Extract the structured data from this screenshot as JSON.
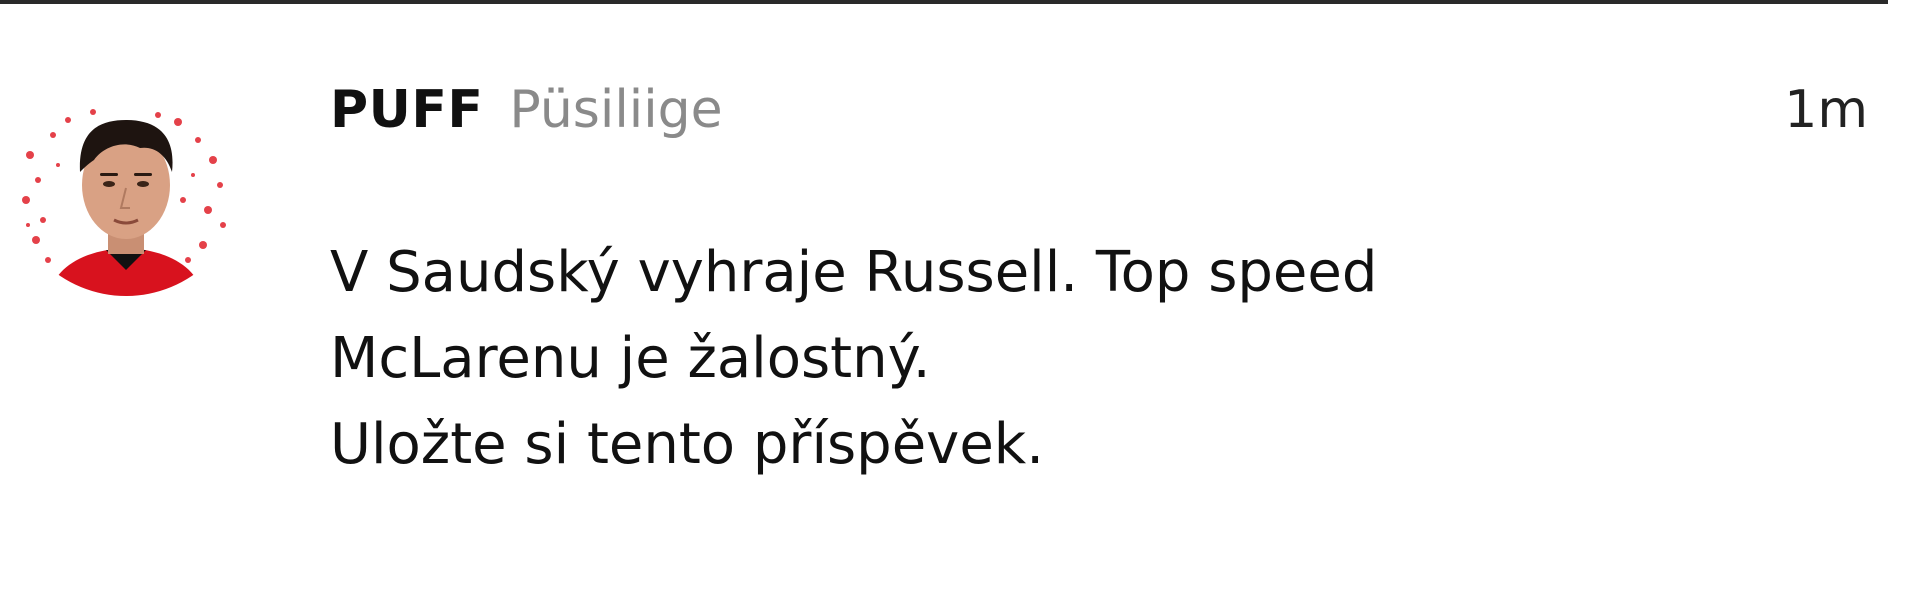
{
  "post": {
    "author": {
      "display_name": "PUFF",
      "username": "Püsiliige",
      "avatar_icon": "profile-photo-avatar"
    },
    "timestamp": "1m",
    "body_lines": [
      "V Saudský vyhraje Russell. Top speed",
      "McLarenu je žalostný.",
      "Uložte si tento příspěvek."
    ]
  },
  "colors": {
    "text_primary": "#111111",
    "text_secondary": "#8a8a8a",
    "background": "#ffffff",
    "divider": "#2a2a2a",
    "avatar_accent": "#e0202a"
  }
}
